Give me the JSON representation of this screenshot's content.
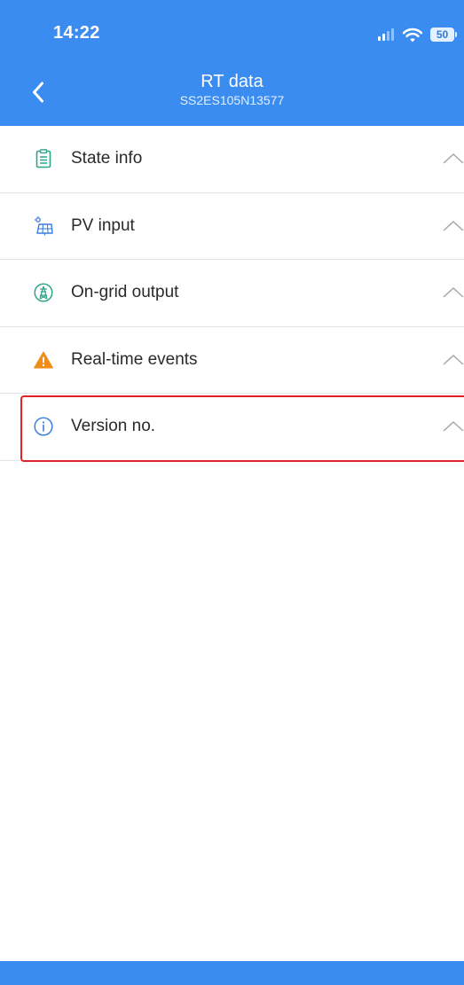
{
  "status_bar": {
    "time": "14:22",
    "battery_level": "50",
    "signal_icon": "cellular-signal-icon",
    "wifi_icon": "wifi-icon"
  },
  "nav": {
    "title": "RT data",
    "subtitle": "SS2ES105N13577",
    "back_icon": "chevron-left-icon"
  },
  "sections": [
    {
      "label": "State info",
      "icon": "clipboard-icon",
      "icon_color": "#2fa58a",
      "expanded": false
    },
    {
      "label": "PV input",
      "icon": "solar-panel-icon",
      "icon_color": "#3b7fe0",
      "expanded": false
    },
    {
      "label": "On-grid output",
      "icon": "transmission-tower-icon",
      "icon_color": "#2fa58a",
      "expanded": false
    },
    {
      "label": "Real-time events",
      "icon": "warning-icon",
      "icon_color": "#f08c1a",
      "expanded": false
    },
    {
      "label": "Version no.",
      "icon": "info-icon",
      "icon_color": "#3b7fe0",
      "expanded": false,
      "highlighted": true
    }
  ],
  "colors": {
    "primary": "#3b8cf0",
    "highlight_border": "#e02424",
    "divider": "#e4e4e4",
    "chevron": "#a8a8a8"
  }
}
